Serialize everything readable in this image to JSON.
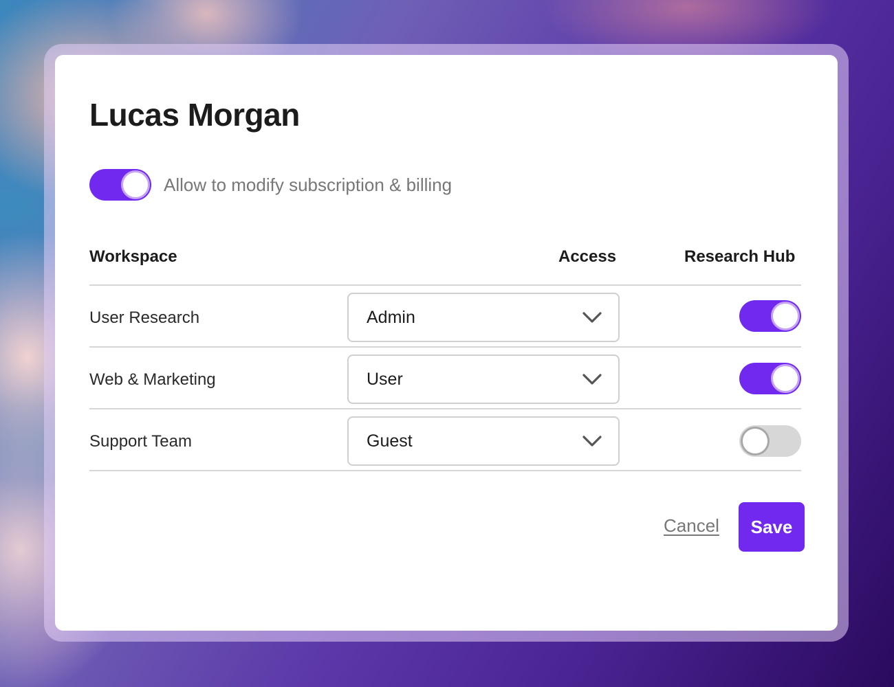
{
  "dialog": {
    "title": "Lucas Morgan",
    "billing_toggle": {
      "label": "Allow to modify subscription & billing",
      "on": true
    },
    "table": {
      "headers": {
        "workspace": "Workspace",
        "access": "Access",
        "hub": "Research Hub"
      },
      "rows": [
        {
          "workspace": "User Research",
          "access": "Admin",
          "hub_on": true
        },
        {
          "workspace": "Web & Marketing",
          "access": "User",
          "hub_on": true
        },
        {
          "workspace": "Support Team",
          "access": "Guest",
          "hub_on": false
        }
      ]
    },
    "actions": {
      "cancel_label": "Cancel",
      "save_label": "Save"
    }
  },
  "icons": {
    "dropdown": "chevron-down-icon"
  },
  "colors": {
    "accent": "#7129f0",
    "knob_ring_on": "#c5a4f5",
    "toggle_off": "#d7d7d7"
  }
}
